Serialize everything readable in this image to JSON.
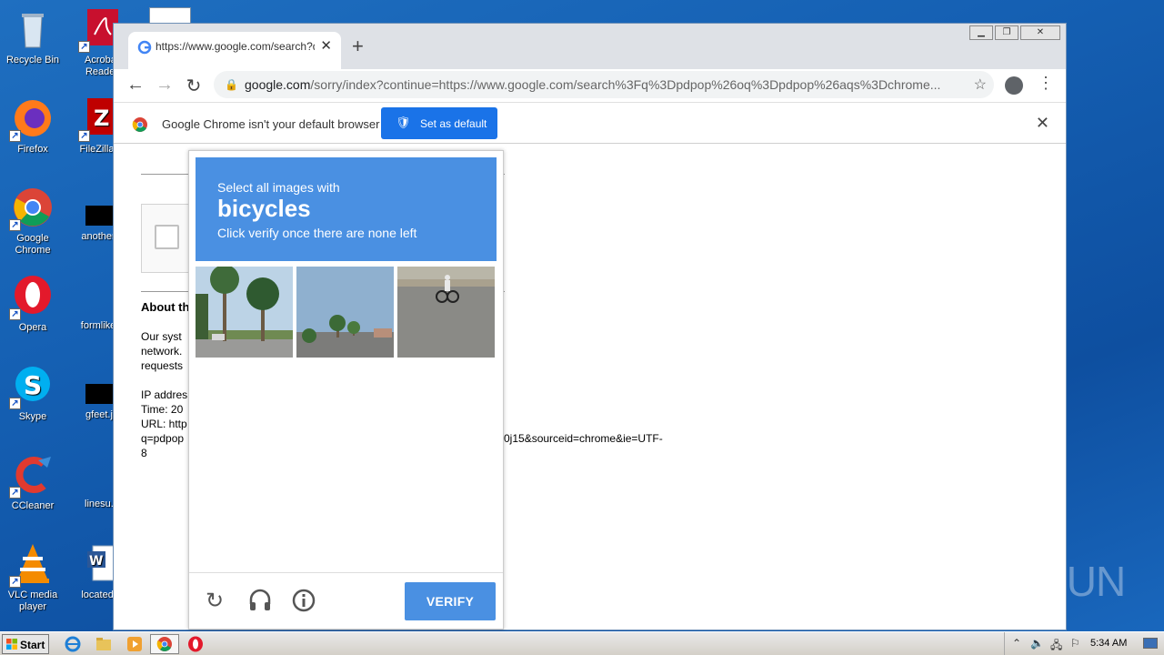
{
  "desktop": {
    "icons": [
      {
        "label": "Recycle Bin"
      },
      {
        "label": "Acrobat Reader"
      },
      {
        "label": "Firefox"
      },
      {
        "label": "FileZilla C"
      },
      {
        "label": "Google Chrome"
      },
      {
        "label": "anotherw"
      },
      {
        "label": "Opera"
      },
      {
        "label": "formlikely"
      },
      {
        "label": "Skype"
      },
      {
        "label": "gfeet.jp"
      },
      {
        "label": "CCleaner"
      },
      {
        "label": "linesu.p"
      },
      {
        "label": "VLC media player"
      },
      {
        "label": "locateder"
      }
    ]
  },
  "browser": {
    "tab_title": "https://www.google.com/search?q=",
    "url_host": "google.com",
    "url_rest": "/sorry/index?continue=https://www.google.com/search%3Fq%3Dpdpop%26oq%3Dpdpop%26aqs%3Dchrome...",
    "infobar_message": "Google Chrome isn't your default browser",
    "set_default_label": "Set as default"
  },
  "page": {
    "about_heading": "About th",
    "para_lines": [
      "Our syst",
      "network.",
      "requests"
    ],
    "ip_line": "IP addres",
    "time_line": "Time: 20",
    "url_line": "URL: http",
    "q_line_left": "q=pdpop",
    "q_line_right": "0j15&sourceid=chrome&ie=UTF-",
    "last_line": "8"
  },
  "captcha": {
    "instruction": "Select all images with",
    "target": "bicycles",
    "subtext": "Click verify once there are none left",
    "verify_label": "VERIFY"
  },
  "watermark": "ANY RUN",
  "taskbar": {
    "start_label": "Start",
    "clock": "5:34 AM"
  }
}
